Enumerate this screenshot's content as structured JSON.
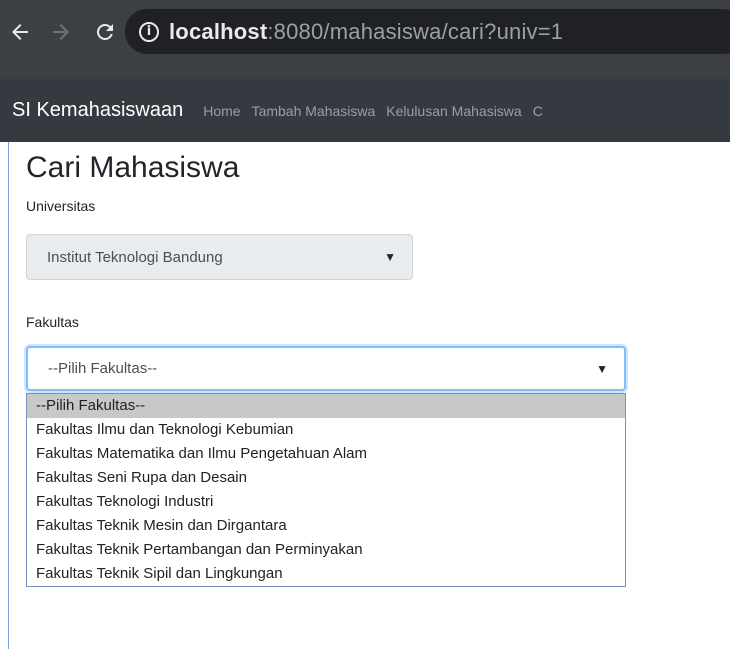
{
  "browser": {
    "url_host": "localhost",
    "url_rest": ":8080/mahasiswa/cari?univ=1",
    "info_glyph": "i"
  },
  "navbar": {
    "brand": "SI Kemahasiswaan",
    "links": [
      "Home",
      "Tambah Mahasiswa",
      "Kelulusan Mahasiswa",
      "C"
    ]
  },
  "page": {
    "title": "Cari Mahasiswa",
    "univ_label": "Universitas",
    "univ_value": "Institut Teknologi Bandung",
    "fak_label": "Fakultas",
    "fak_value": "--Pilih Fakultas--",
    "options": [
      "--Pilih Fakultas--",
      "Fakultas Ilmu dan Teknologi Kebumian",
      "Fakultas Matematika dan Ilmu Pengetahuan Alam",
      "Fakultas Seni Rupa dan Desain",
      "Fakultas Teknologi Industri",
      "Fakultas Teknik Mesin dan Dirgantara",
      "Fakultas Teknik Pertambangan dan Perminyakan",
      "Fakultas Teknik Sipil dan Lingkungan"
    ],
    "selected_option_index": 0
  },
  "icons": {
    "back": "arrow-left-icon",
    "forward": "arrow-right-icon",
    "reload": "reload-icon",
    "info": "info-icon",
    "select_arrow": "caret-down-icon"
  },
  "colors": {
    "browser_bar": "#3c4043",
    "navbar": "#343a40",
    "focus_border": "#80bdff",
    "selected_option": "#c8c8c8"
  }
}
